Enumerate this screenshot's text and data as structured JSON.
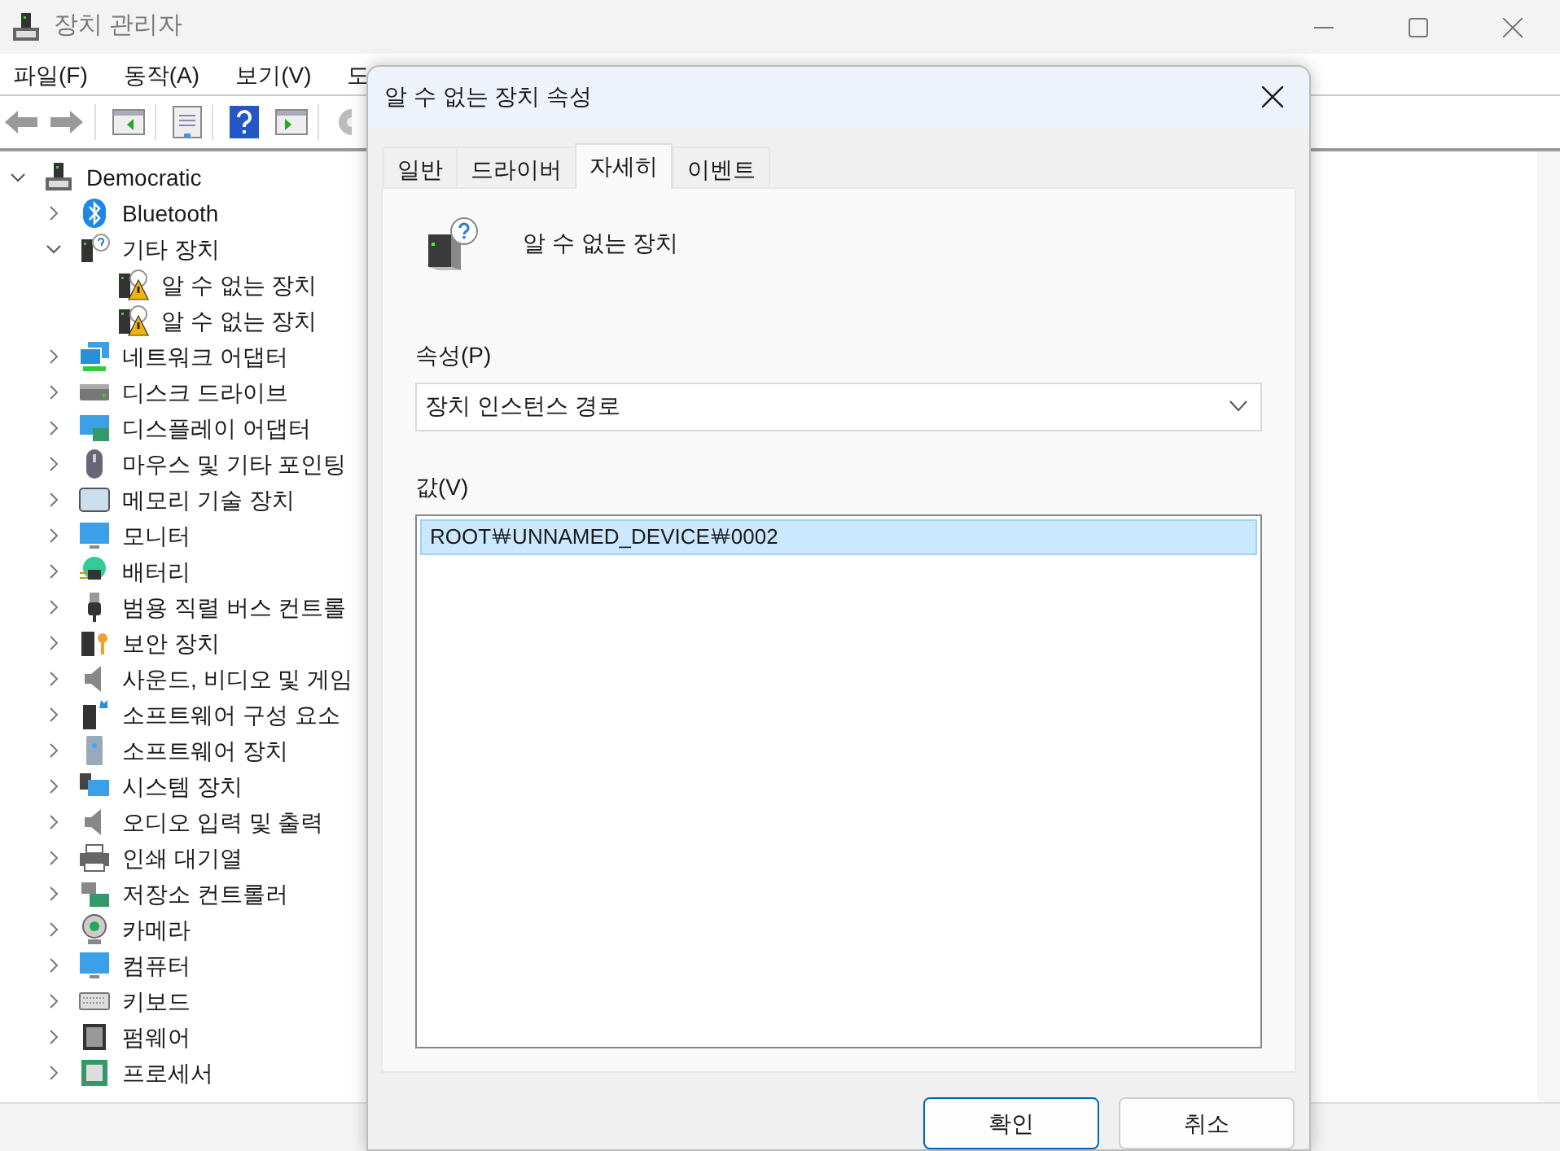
{
  "window": {
    "title": "장치 관리자"
  },
  "menu": [
    "파일(F)",
    "동작(A)",
    "보기(V)",
    "도"
  ],
  "tree": {
    "label": "Democratic",
    "expanded": true,
    "children": [
      {
        "label": "Bluetooth",
        "expanded": false
      },
      {
        "label": "기타 장치",
        "expanded": true,
        "children": [
          {
            "label": "알 수 없는 장치",
            "kind": "warning"
          },
          {
            "label": "알 수 없는 장치",
            "kind": "warning"
          }
        ]
      },
      {
        "label": "네트워크 어댑터",
        "expanded": false
      },
      {
        "label": "디스크 드라이브",
        "expanded": false
      },
      {
        "label": "디스플레이 어댑터",
        "expanded": false
      },
      {
        "label": "마우스 및 기타 포인팅",
        "expanded": false
      },
      {
        "label": "메모리 기술 장치",
        "expanded": false
      },
      {
        "label": "모니터",
        "expanded": false
      },
      {
        "label": "배터리",
        "expanded": false
      },
      {
        "label": "범용 직렬 버스 컨트롤",
        "expanded": false
      },
      {
        "label": "보안 장치",
        "expanded": false
      },
      {
        "label": "사운드, 비디오 및 게임",
        "expanded": false
      },
      {
        "label": "소프트웨어 구성 요소",
        "expanded": false
      },
      {
        "label": "소프트웨어 장치",
        "expanded": false
      },
      {
        "label": "시스템 장치",
        "expanded": false
      },
      {
        "label": "오디오 입력 및 출력",
        "expanded": false
      },
      {
        "label": "인쇄 대기열",
        "expanded": false
      },
      {
        "label": "저장소 컨트롤러",
        "expanded": false
      },
      {
        "label": "카메라",
        "expanded": false
      },
      {
        "label": "컴퓨터",
        "expanded": false
      },
      {
        "label": "키보드",
        "expanded": false
      },
      {
        "label": "펌웨어",
        "expanded": false
      },
      {
        "label": "프로세서",
        "expanded": false
      }
    ]
  },
  "dialog": {
    "title": "알 수 없는 장치 속성",
    "tabs": [
      {
        "label": "일반",
        "selected": false
      },
      {
        "label": "드라이버",
        "selected": false
      },
      {
        "label": "자세히",
        "selected": true
      },
      {
        "label": "이벤트",
        "selected": false
      }
    ],
    "device_name": "알 수 없는 장치",
    "property": {
      "label": "속성(P)",
      "value": "장치 인스턴스 경로"
    },
    "value_label": "값(V)",
    "values": [
      {
        "text": "ROOT￦UNNAMED_DEVICE￦0002",
        "selected": true
      }
    ],
    "buttons": [
      {
        "label": "확인",
        "default": true
      },
      {
        "label": "취소",
        "default": false
      }
    ]
  }
}
